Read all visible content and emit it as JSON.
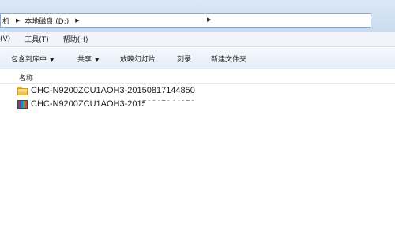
{
  "address": {
    "crumb1": "机",
    "crumb2": "本地磁盘 (D:)"
  },
  "menubar": [
    "(V)",
    "工具(T)",
    "帮助(H)"
  ],
  "toolbar": {
    "include_library": "包含到库中",
    "share": "共享",
    "slideshow": "放映幻灯片",
    "burn": "刻录",
    "new_folder": "新建文件夹"
  },
  "columns": {
    "name": "名称"
  },
  "files": [
    {
      "name": "CHC-N9200ZCU1AOH3-20150817144850",
      "icon": "folder-icon"
    },
    {
      "name": "CHC-N9200ZCU1AOH3-20150817144850",
      "icon": "archive-icon"
    }
  ]
}
